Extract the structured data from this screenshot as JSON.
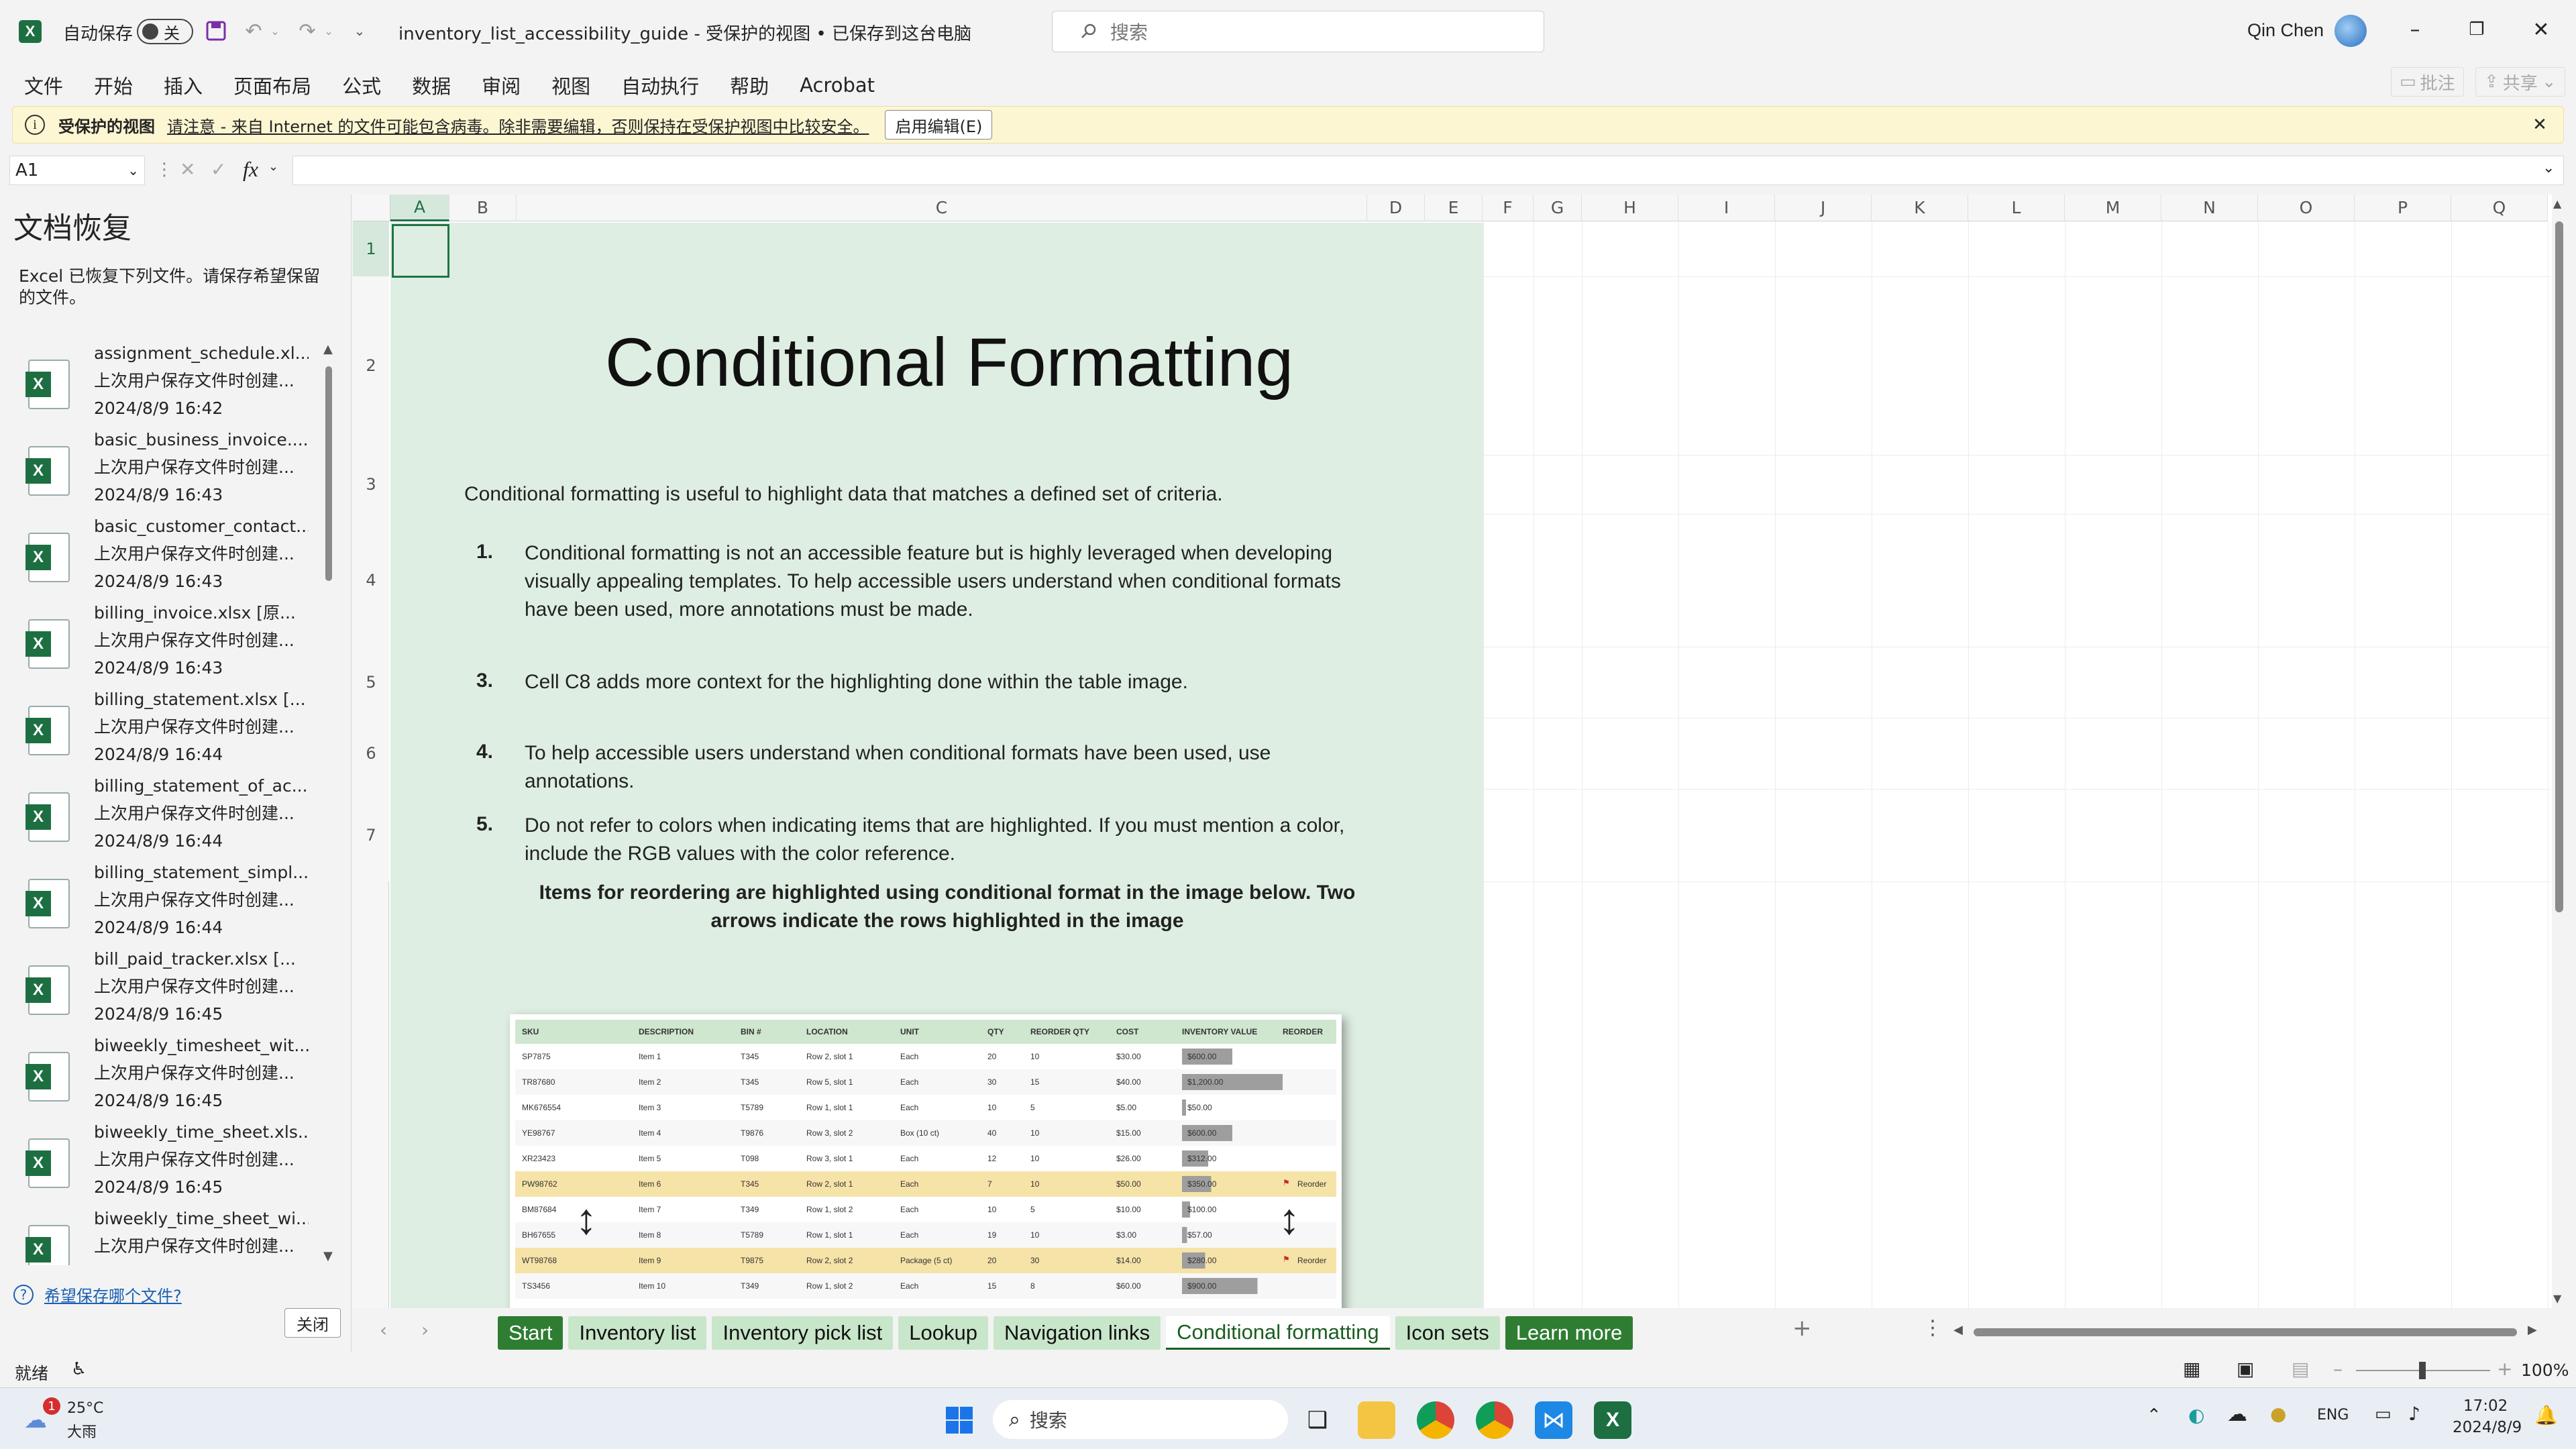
{
  "titlebar": {
    "autosave_label": "自动保存",
    "autosave_state": "关",
    "doc_title": "inventory_list_accessibility_guide  -  受保护的视图 • 已保存到这台电脑",
    "search_placeholder": "搜索",
    "user_name": "Qin Chen"
  },
  "menu": [
    "文件",
    "开始",
    "插入",
    "页面布局",
    "公式",
    "数据",
    "审阅",
    "视图",
    "自动执行",
    "帮助",
    "Acrobat"
  ],
  "menu_right": {
    "comments": "批注",
    "share": "共享"
  },
  "protected_bar": {
    "title": "受保护的视图",
    "message": "请注意 - 来自 Internet 的文件可能包含病毒。除非需要编辑，否则保持在受保护视图中比较安全。",
    "button": "启用编辑(E)"
  },
  "formula": {
    "name_box": "A1",
    "fx": "fx",
    "value": ""
  },
  "recovery": {
    "title": "文档恢复",
    "description": "Excel 已恢复下列文件。请保存希望保留的文件。",
    "items": [
      {
        "name": "assignment_schedule.xl...",
        "status": "上次用户保存文件时创建...",
        "time": "2024/8/9 16:42"
      },
      {
        "name": "basic_business_invoice....",
        "status": "上次用户保存文件时创建...",
        "time": "2024/8/9 16:43"
      },
      {
        "name": "basic_customer_contact...",
        "status": "上次用户保存文件时创建...",
        "time": "2024/8/9 16:43"
      },
      {
        "name": "billing_invoice.xlsx  [原...",
        "status": "上次用户保存文件时创建...",
        "time": "2024/8/9 16:43"
      },
      {
        "name": "billing_statement.xlsx  [...",
        "status": "上次用户保存文件时创建...",
        "time": "2024/8/9 16:44"
      },
      {
        "name": "billing_statement_of_ac...",
        "status": "上次用户保存文件时创建...",
        "time": "2024/8/9 16:44"
      },
      {
        "name": "billing_statement_simpl...",
        "status": "上次用户保存文件时创建...",
        "time": "2024/8/9 16:44"
      },
      {
        "name": "bill_paid_tracker.xlsx  [...",
        "status": "上次用户保存文件时创建...",
        "time": "2024/8/9 16:45"
      },
      {
        "name": "biweekly_timesheet_wit...",
        "status": "上次用户保存文件时创建...",
        "time": "2024/8/9 16:45"
      },
      {
        "name": "biweekly_time_sheet.xls...",
        "status": "上次用户保存文件时创建...",
        "time": "2024/8/9 16:45"
      },
      {
        "name": "biweekly_time_sheet_wi...",
        "status": "上次用户保存文件时创建...",
        "time": "2024/8/9 16:45"
      }
    ],
    "help_link": "希望保存哪个文件?",
    "close_button": "关闭"
  },
  "columns": [
    "A",
    "B",
    "C",
    "D",
    "E",
    "F",
    "G",
    "H",
    "I",
    "J",
    "K",
    "L",
    "M",
    "N",
    "O",
    "P",
    "Q"
  ],
  "rows": [
    "1",
    "2",
    "3",
    "4",
    "5",
    "6",
    "7"
  ],
  "sheet": {
    "heading": "Conditional Formatting",
    "intro": "Conditional formatting is useful to highlight data that matches a defined set of criteria.",
    "points": [
      {
        "num": "1.",
        "text": "Conditional formatting is not an accessible feature but is highly leveraged when developing visually appealing templates. To help accessible users understand when conditional formats have been used, more annotations must be made."
      },
      {
        "num": "3.",
        "text": "Cell C8 adds more context for the highlighting done within the table image."
      },
      {
        "num": "4.",
        "text": "To help accessible users understand when conditional formats have been used, use annotations."
      },
      {
        "num": "5.",
        "text": "Do not refer to colors when indicating items that are highlighted. If you must mention a color, include the RGB values with the color reference."
      }
    ],
    "callout": "Items for reordering are highlighted using conditional format in the image below. Two arrows indicate the rows highlighted in the image"
  },
  "table_image": {
    "headers": [
      "SKU",
      "DESCRIPTION",
      "BIN #",
      "LOCATION",
      "UNIT",
      "QTY",
      "REORDER QTY",
      "COST",
      "INVENTORY VALUE",
      "REORDER"
    ],
    "rows": [
      {
        "sku": "SP7875",
        "desc": "Item 1",
        "bin": "T345",
        "loc": "Row 2, slot 1",
        "unit": "Each",
        "qty": "20",
        "rqty": "10",
        "cost": "$30.00",
        "value": "$600.00",
        "reorder": "",
        "highlight": false,
        "value_fraction": 0.5
      },
      {
        "sku": "TR87680",
        "desc": "Item 2",
        "bin": "T345",
        "loc": "Row 5, slot 1",
        "unit": "Each",
        "qty": "30",
        "rqty": "15",
        "cost": "$40.00",
        "value": "$1,200.00",
        "reorder": "",
        "highlight": false,
        "value_fraction": 1.0
      },
      {
        "sku": "MK676554",
        "desc": "Item 3",
        "bin": "T5789",
        "loc": "Row 1, slot 1",
        "unit": "Each",
        "qty": "10",
        "rqty": "5",
        "cost": "$5.00",
        "value": "$50.00",
        "reorder": "",
        "highlight": false,
        "value_fraction": 0.04
      },
      {
        "sku": "YE98767",
        "desc": "Item 4",
        "bin": "T9876",
        "loc": "Row 3, slot 2",
        "unit": "Box (10 ct)",
        "qty": "40",
        "rqty": "10",
        "cost": "$15.00",
        "value": "$600.00",
        "reorder": "",
        "highlight": false,
        "value_fraction": 0.5
      },
      {
        "sku": "XR23423",
        "desc": "Item 5",
        "bin": "T098",
        "loc": "Row 3, slot 1",
        "unit": "Each",
        "qty": "12",
        "rqty": "10",
        "cost": "$26.00",
        "value": "$312.00",
        "reorder": "",
        "highlight": false,
        "value_fraction": 0.26
      },
      {
        "sku": "PW98762",
        "desc": "Item 6",
        "bin": "T345",
        "loc": "Row 2, slot 1",
        "unit": "Each",
        "qty": "7",
        "rqty": "10",
        "cost": "$50.00",
        "value": "$350.00",
        "reorder": "Reorder",
        "highlight": true,
        "value_fraction": 0.29
      },
      {
        "sku": "BM87684",
        "desc": "Item 7",
        "bin": "T349",
        "loc": "Row 1, slot 2",
        "unit": "Each",
        "qty": "10",
        "rqty": "5",
        "cost": "$10.00",
        "value": "$100.00",
        "reorder": "",
        "highlight": false,
        "value_fraction": 0.08
      },
      {
        "sku": "BH67655",
        "desc": "Item 8",
        "bin": "T5789",
        "loc": "Row 1, slot 1",
        "unit": "Each",
        "qty": "19",
        "rqty": "10",
        "cost": "$3.00",
        "value": "$57.00",
        "reorder": "",
        "highlight": false,
        "value_fraction": 0.05
      },
      {
        "sku": "WT98768",
        "desc": "Item 9",
        "bin": "T9875",
        "loc": "Row 2, slot 2",
        "unit": "Package (5 ct)",
        "qty": "20",
        "rqty": "30",
        "cost": "$14.00",
        "value": "$280.00",
        "reorder": "Reorder",
        "highlight": true,
        "value_fraction": 0.23
      },
      {
        "sku": "TS3456",
        "desc": "Item 10",
        "bin": "T349",
        "loc": "Row 1, slot 2",
        "unit": "Each",
        "qty": "15",
        "rqty": "8",
        "cost": "$60.00",
        "value": "$900.00",
        "reorder": "",
        "highlight": false,
        "value_fraction": 0.75
      }
    ]
  },
  "tabs": [
    {
      "label": "Start",
      "style": "dark"
    },
    {
      "label": "Inventory list",
      "style": "light"
    },
    {
      "label": "Inventory pick list",
      "style": "light"
    },
    {
      "label": "Lookup",
      "style": "light"
    },
    {
      "label": "Navigation links",
      "style": "light"
    },
    {
      "label": "Conditional formatting",
      "style": "active"
    },
    {
      "label": "Icon sets",
      "style": "light"
    },
    {
      "label": "Learn more",
      "style": "dark"
    }
  ],
  "status": {
    "ready": "就绪",
    "zoom": "100%"
  },
  "taskbar": {
    "weather_temp": "25°C",
    "weather_desc": "大雨",
    "weather_badge": "1",
    "search_placeholder": "搜索",
    "lang": "ENG",
    "time": "17:02",
    "date": "2024/8/9"
  },
  "colors": {
    "excel_green": "#217346",
    "sheet_bg": "#dfeee2",
    "tab_dark": "#2e7d32",
    "tab_light": "#c8e6c9",
    "highlight_row": "#f6e3a8",
    "message_bar": "#fdf6d2"
  }
}
